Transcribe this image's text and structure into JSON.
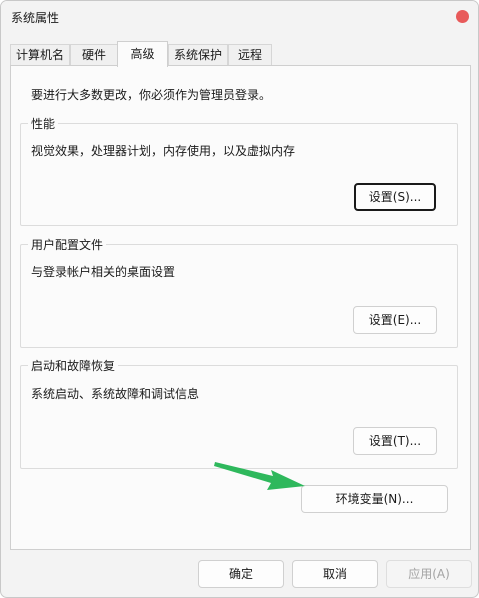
{
  "window": {
    "title": "系统属性"
  },
  "tabs": [
    {
      "label": "计算机名",
      "active": false
    },
    {
      "label": "硬件",
      "active": false
    },
    {
      "label": "高级",
      "active": true
    },
    {
      "label": "系统保护",
      "active": false
    },
    {
      "label": "远程",
      "active": false
    }
  ],
  "advanced": {
    "admin_notice": "要进行大多数更改，你必须作为管理员登录。",
    "performance": {
      "title": "性能",
      "description": "视觉效果，处理器计划，内存使用，以及虚拟内存",
      "button": "设置(S)..."
    },
    "user_profiles": {
      "title": "用户配置文件",
      "description": "与登录帐户相关的桌面设置",
      "button": "设置(E)..."
    },
    "startup_recovery": {
      "title": "启动和故障恢复",
      "description": "系统启动、系统故障和调试信息",
      "button": "设置(T)..."
    },
    "env_button": "环境变量(N)..."
  },
  "footer": {
    "ok": "确定",
    "cancel": "取消",
    "apply": "应用(A)"
  },
  "colors": {
    "close": "#e85a5a",
    "arrow": "#2eb85c"
  },
  "icons": {
    "close": "close-icon",
    "annotation": "green-arrow-icon"
  }
}
